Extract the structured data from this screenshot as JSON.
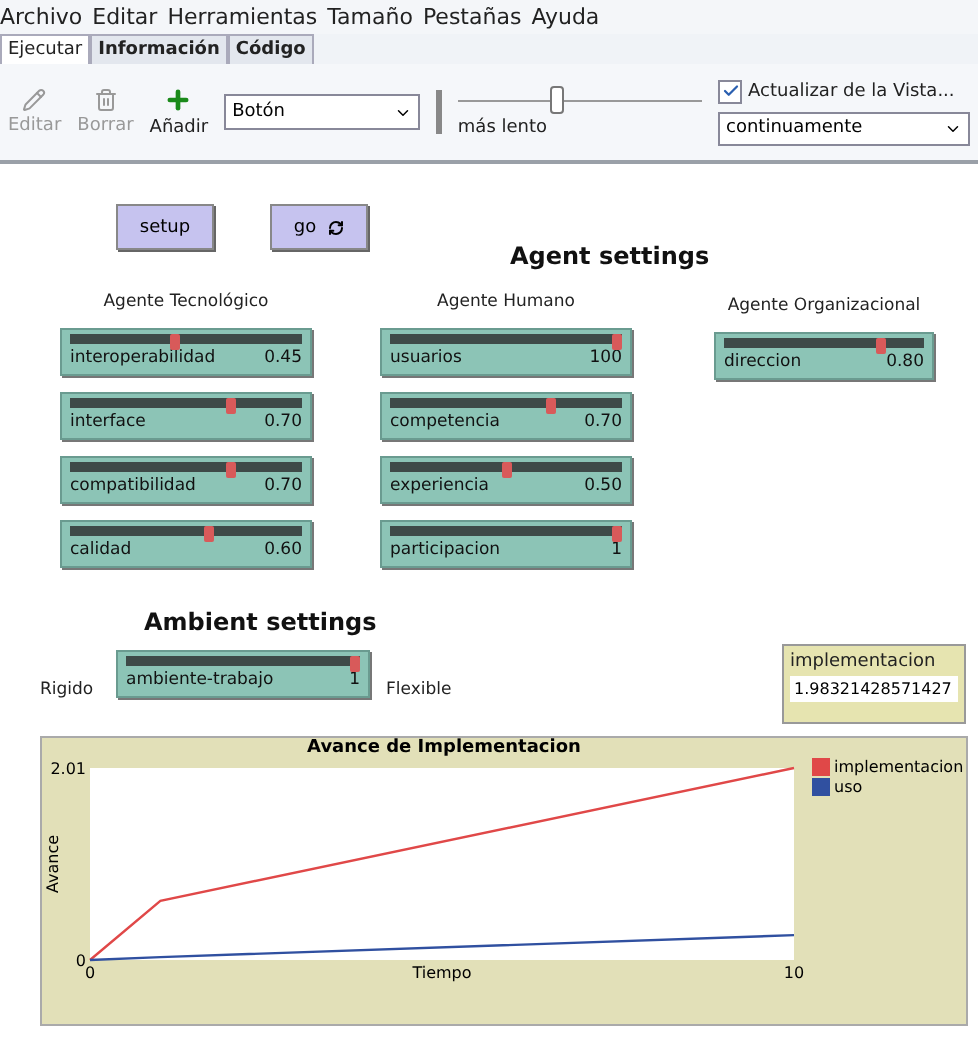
{
  "menu": [
    "Archivo",
    "Editar",
    "Herramientas",
    "Tamaño",
    "Pestañas",
    "Ayuda"
  ],
  "tabs": [
    {
      "label": "Ejecutar",
      "selected": true
    },
    {
      "label": "Información",
      "selected": false
    },
    {
      "label": "Código",
      "selected": false
    }
  ],
  "toolbar": {
    "tools": [
      {
        "kind": "edit",
        "label": "Editar",
        "disabled": true
      },
      {
        "kind": "delete",
        "label": "Borrar",
        "disabled": true
      },
      {
        "kind": "add",
        "label": "Añadir",
        "disabled": false
      }
    ],
    "widget_type": "Botón",
    "speed_label": "más lento",
    "speed": {
      "level": 0.38
    },
    "view_updates": {
      "label": "Actualizar de la Vista...",
      "checked": true
    },
    "update_mode": "continuamente"
  },
  "buttons": [
    {
      "label": "setup",
      "forever": false
    },
    {
      "label": "go",
      "forever": true
    }
  ],
  "agent_title": "Agent settings",
  "groups": [
    {
      "title": "Agente Tecnológico",
      "sliders": [
        {
          "name": "interoperabilidad",
          "value": "0.45",
          "level": 0.45
        },
        {
          "name": "interface",
          "value": "0.70",
          "level": 0.7
        },
        {
          "name": "compatibilidad",
          "value": "0.70",
          "level": 0.7
        },
        {
          "name": "calidad",
          "value": "0.60",
          "level": 0.6
        }
      ]
    },
    {
      "title": "Agente Humano",
      "sliders": [
        {
          "name": "usuarios",
          "value": "100",
          "level": 1
        },
        {
          "name": "competencia",
          "value": "0.70",
          "level": 0.7
        },
        {
          "name": "experiencia",
          "value": "0.50",
          "level": 0.5
        },
        {
          "name": "participacion",
          "value": "1",
          "level": 1
        }
      ]
    },
    {
      "title": "Agente Organizacional",
      "sliders": [
        {
          "name": "direccion",
          "value": "0.80",
          "level": 0.8
        }
      ]
    }
  ],
  "ambient": {
    "title": "Ambient settings",
    "left": "Rigido",
    "right": "Flexible",
    "slider": {
      "name": "ambiente-trabajo",
      "value": "1",
      "level": 1
    }
  },
  "monitor": {
    "label": "implementacion",
    "value": "1.98321428571427"
  },
  "plot": {
    "title": "Avance de Implementacion",
    "chart_data": {
      "type": "line",
      "xlabel": "Tiempo",
      "ylabel": "Avance",
      "x": [
        0,
        1,
        10
      ],
      "xlim": [
        0,
        10
      ],
      "ylim": [
        0,
        2.01
      ],
      "xticks": [
        0,
        10
      ],
      "yticks": [
        0,
        2.01
      ],
      "series": [
        {
          "name": "implementacion",
          "color": "#e04848",
          "values": [
            0,
            0.62,
            2.01
          ]
        },
        {
          "name": "uso",
          "color": "#3050a0",
          "values": [
            0,
            0.03,
            0.26
          ]
        }
      ]
    }
  }
}
